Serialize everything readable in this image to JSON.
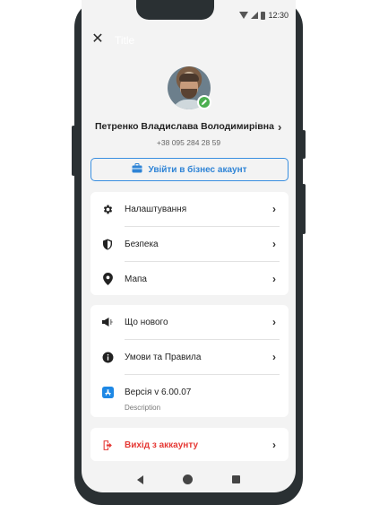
{
  "header": {
    "title": "Title",
    "status_time": "12:30"
  },
  "profile": {
    "name": "Петренко Владислава Володимирівна",
    "phone": "+38 095 284 28 59"
  },
  "business_button": {
    "label": "Увійти в бізнес акаунт",
    "accent": "#2f84d6"
  },
  "menu_main": [
    {
      "label": "Налаштування",
      "icon": "gear-icon"
    },
    {
      "label": "Безпека",
      "icon": "shield-icon"
    },
    {
      "label": "Мапа",
      "icon": "map-pin-icon"
    }
  ],
  "menu_info": [
    {
      "label": "Що нового",
      "icon": "megaphone-icon"
    },
    {
      "label": "Умови та Правила",
      "icon": "info-icon"
    },
    {
      "label": "Версія v 6.00.07",
      "description": "Description",
      "icon": "app-store-icon"
    }
  ],
  "logout": {
    "label": "Вихід з аккаунту",
    "color": "#e53935",
    "icon": "logout-icon"
  }
}
